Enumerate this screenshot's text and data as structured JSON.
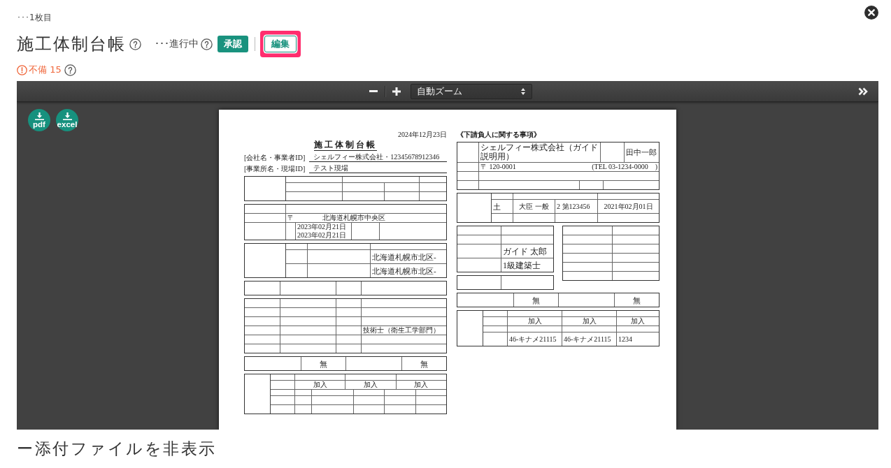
{
  "header": {
    "page_indicator": "･･･1枚目",
    "title": "施工体制台帳",
    "status": "･･･進行中",
    "buttons": [
      {
        "label": "承認",
        "kind": "primary",
        "highlighted": false
      },
      {
        "label": "編集",
        "kind": "outline",
        "highlighted": true
      }
    ],
    "issues": "不備 15"
  },
  "viewer": {
    "zoom": "自動ズーム",
    "downloads": [
      {
        "label": "pdf"
      },
      {
        "label": "excel"
      }
    ],
    "document": {
      "date": "2024年12月23日",
      "title": "施工体制台帳",
      "company_label": "[会社名・事業者ID]",
      "company": "シェルフィー株式会社・12345678912346",
      "site_label": "[事業所名・現場ID]",
      "site": "テスト現場",
      "postal_mark": "〒",
      "address": "北海道札幌市中央区",
      "period": [
        "2023年02月21日",
        "2023年02月21日"
      ],
      "contract_addresses": [
        "北海道札幌市北区-",
        "北海道札幌市北区-"
      ],
      "qualification": "技術士（衛生工学部門）",
      "flags": [
        "無",
        "無"
      ],
      "insurance": [
        "加入",
        "加入",
        "加入"
      ],
      "subcontractor": {
        "heading": "《下請負人に関する事項》",
        "company": "シェルフィー株式会社（ガイド説明用）",
        "representative": "田中一郎",
        "postal": "〒 120-0001",
        "tel": "(TEL 03-1234-0000　)",
        "license": [
          "土",
          "大臣 一般",
          "2 第123456",
          "2021年02月01日"
        ],
        "engineer": "ガイド 太郎",
        "engineer_qualification": "1級建築士",
        "flags": [
          "無",
          "無"
        ],
        "insurance": [
          "加入",
          "加入",
          "加入"
        ],
        "insurance_numbers": [
          "46-キナメ21115",
          "46-キナメ21115",
          "1234"
        ]
      }
    }
  },
  "footer": {
    "toggle": "ー添付ファイルを非表示"
  }
}
